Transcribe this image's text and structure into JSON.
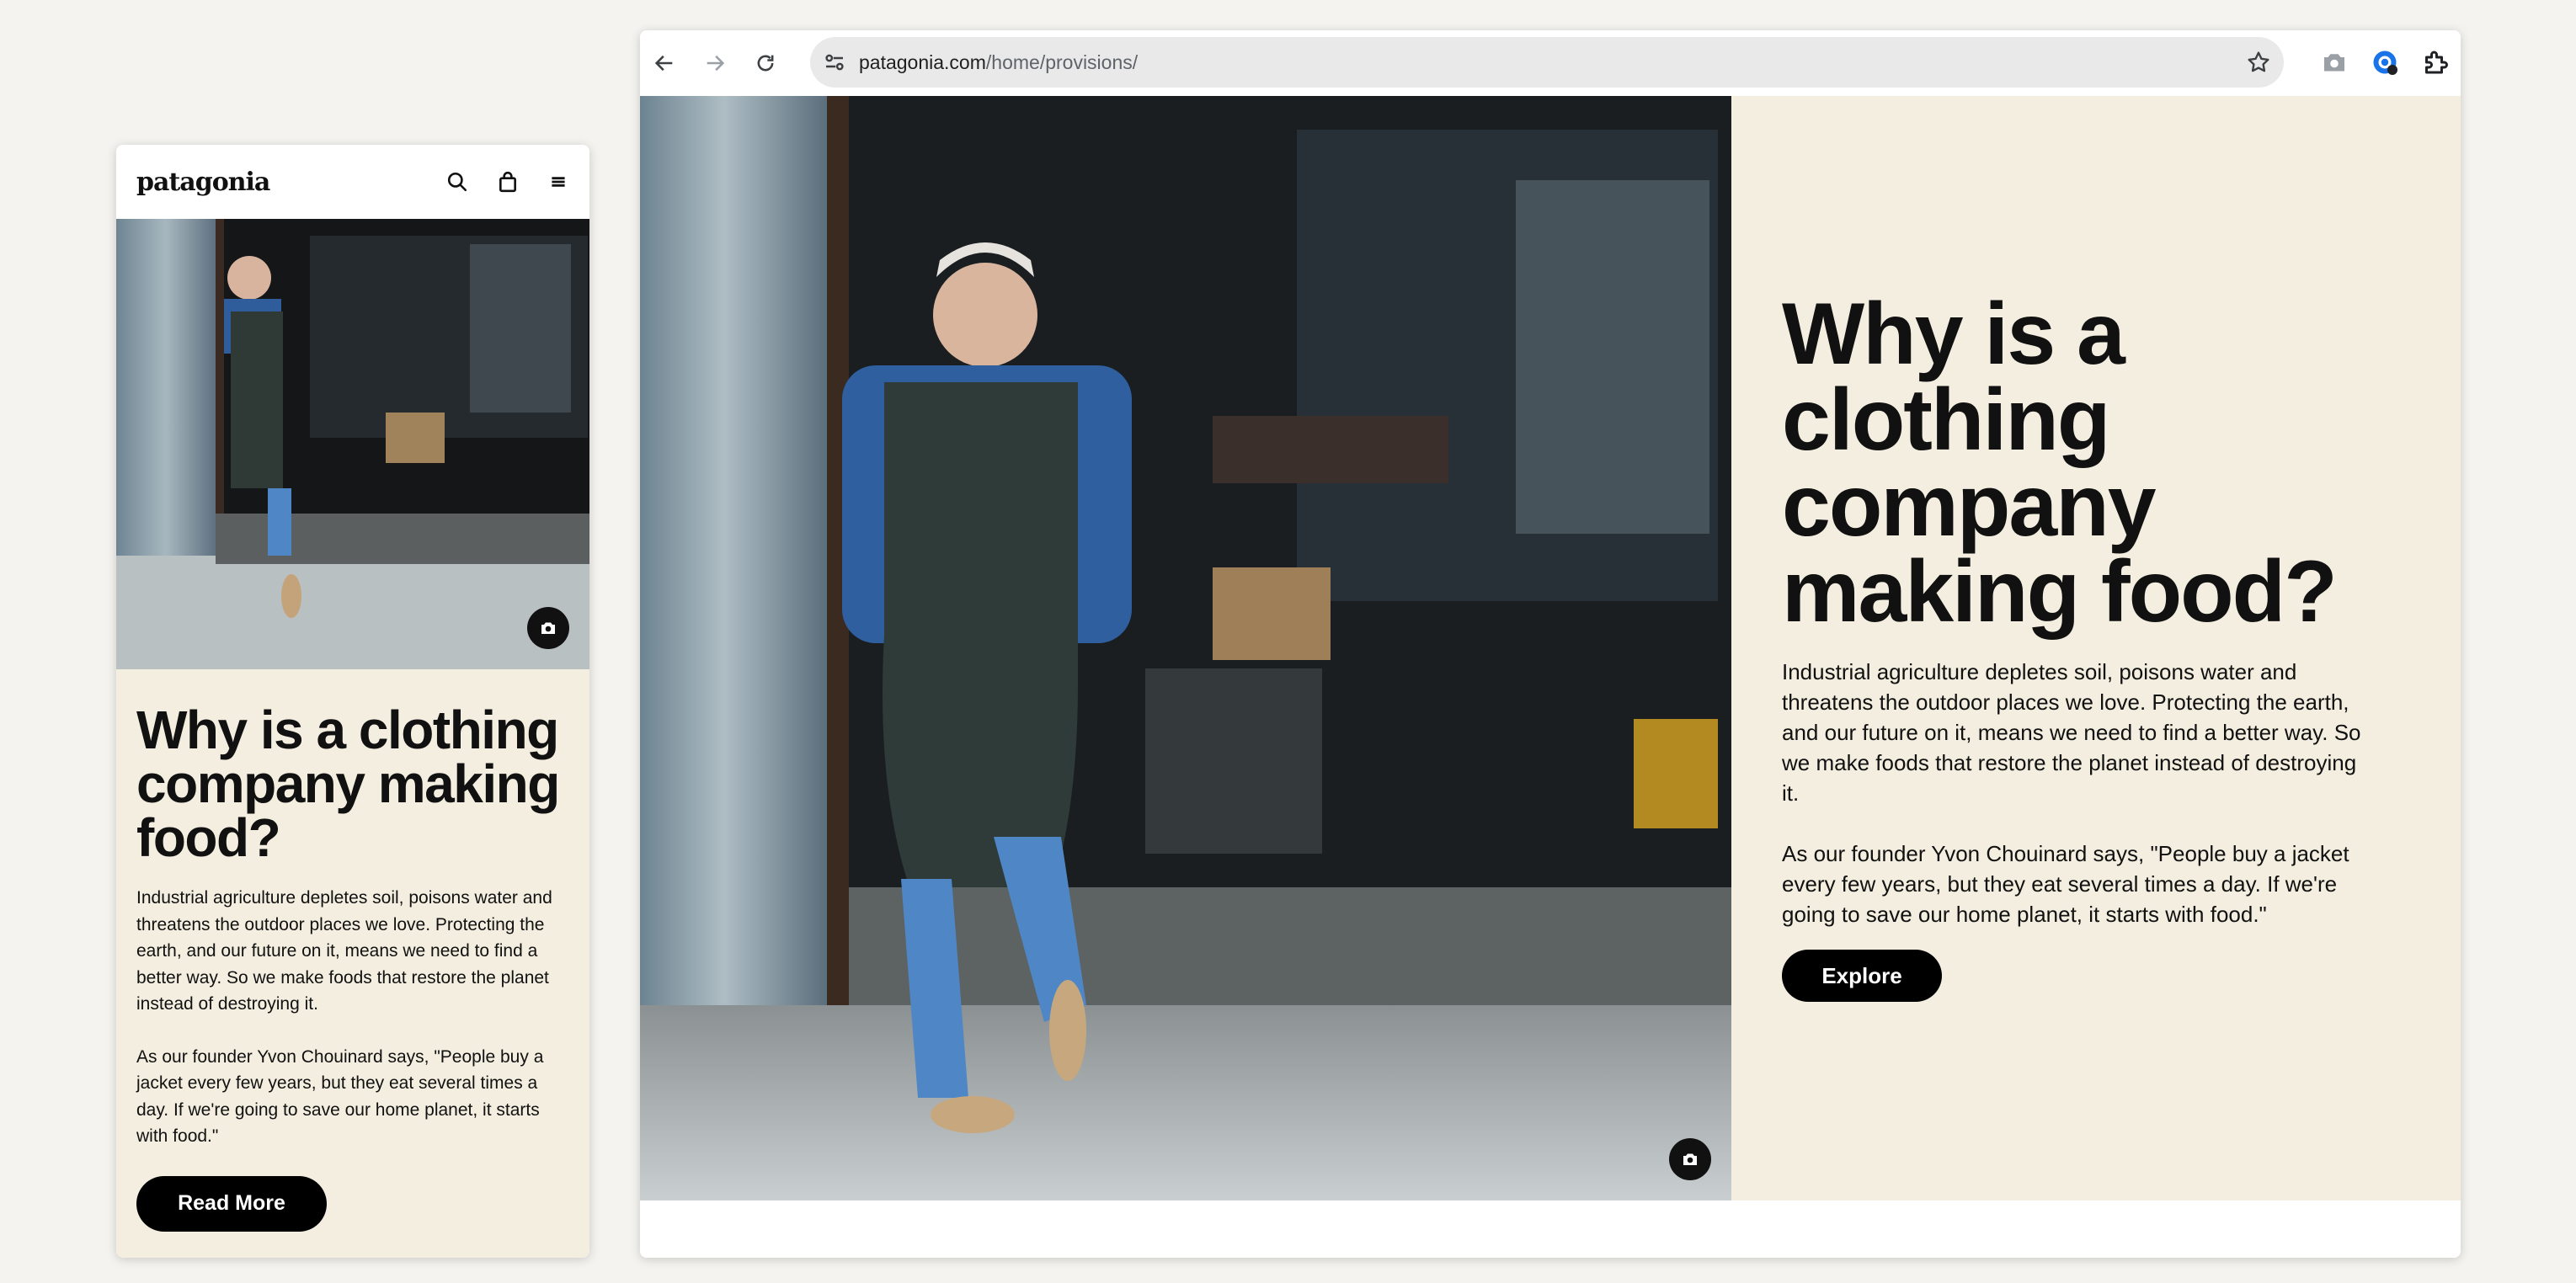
{
  "mobile": {
    "logo": "patagonia",
    "icons": [
      "search-icon",
      "bag-icon",
      "menu-icon"
    ],
    "title": "Why is a clothing company making food?",
    "paragraph1": "Industrial agriculture depletes soil, poisons water and threatens the outdoor places we love. Protecting the earth, and our future on it, means we need to find a better way. So we make foods that restore the planet instead of destroying it.",
    "paragraph2": "As our founder Yvon Chouinard says, \"People buy a jacket every few years, but they eat several times a day. If we're going to save our home planet, it starts with food.\"",
    "button": "Read More"
  },
  "browser": {
    "url_domain": "patagonia.com",
    "url_path": "/home/provisions/",
    "toolbar_icons": [
      "back-icon",
      "forward-icon",
      "reload-icon",
      "site-settings-icon",
      "bookmark-star-icon",
      "screenshot-icon",
      "profile-extension-icon",
      "extensions-puzzle-icon"
    ],
    "title": "Why is a clothing company making food?",
    "paragraph1": "Industrial agriculture depletes soil, poisons water and threatens the outdoor places we love. Protecting the earth, and our future on it, means we need to find a better way. So we make foods that restore the planet instead of destroying it.",
    "paragraph2": "As our founder Yvon Chouinard says, \"People buy a jacket every few years, but they eat several times a day. If we're going to save our home planet, it starts with food.\"",
    "button": "Explore"
  },
  "colors": {
    "cream": "#f3eedf",
    "button": "#000000",
    "page_bg": "#f4f3ef"
  }
}
